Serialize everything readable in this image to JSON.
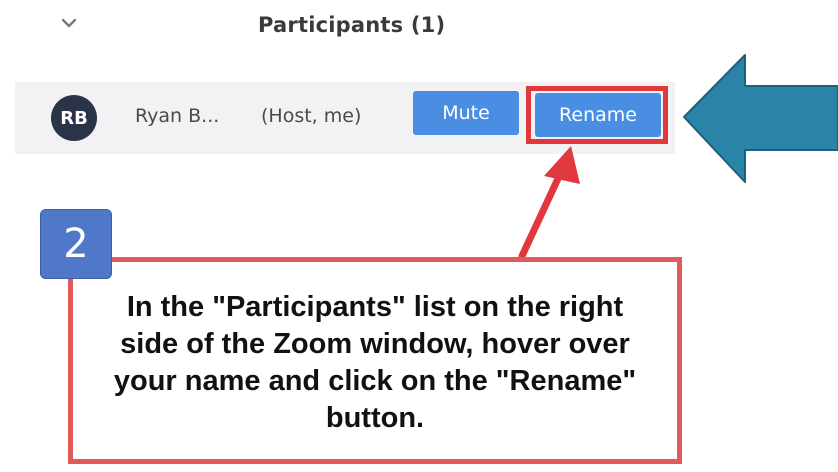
{
  "participants_panel": {
    "title": "Participants (1)",
    "collapse_icon": "chevron-down-icon",
    "participant": {
      "initials": "RB",
      "name": "Ryan B...",
      "role": "(Host, me)",
      "mute_label": "Mute",
      "rename_label": "Rename"
    },
    "colors": {
      "button_blue": "#4a8ee4",
      "avatar_bg": "#2b3348",
      "row_bg": "#f2f2f4"
    }
  },
  "annotation": {
    "step_number": "2",
    "instruction": "In the \"Participants\" list on the right side of the Zoom window, hover over your name and click on the \"Rename\" button.",
    "pointer_arrow_icon": "big-arrow-left-icon",
    "callout_arrow_icon": "arrow-up-icon",
    "colors": {
      "highlight_red": "#e0383c",
      "big_arrow_teal": "#2a84a8",
      "step_badge_blue": "#4f78c8"
    }
  }
}
